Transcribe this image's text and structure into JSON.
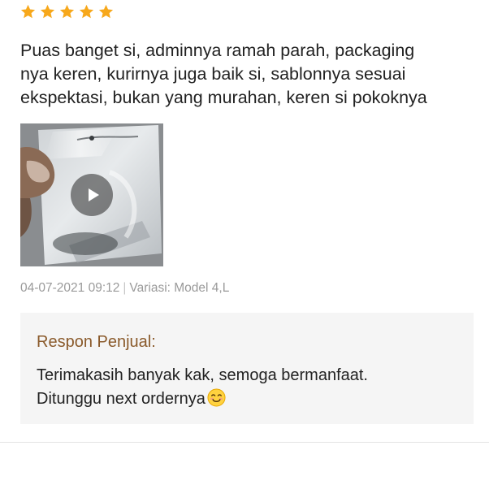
{
  "review": {
    "rating": 5,
    "max_rating": 5,
    "star_color": "#f7a81b",
    "text": "Puas banget si, adminnya ramah parah, packaging\nnya keren, kurirnya juga baik si, sablonnya sesuai\nekspektasi, bukan yang murahan, keren si pokoknya",
    "media": {
      "type": "video",
      "icon": "play-icon"
    },
    "date": "04-07-2021 09:12",
    "separator": "|",
    "variation": "Variasi: Model 4,L"
  },
  "seller_reply": {
    "label": "Respon Penjual:",
    "label_color": "#8a5a2b",
    "text": "Terimakasih banyak kak, semoga bermanfaat.\nDitunggu next ordernya",
    "emoji": "smiling-face-emoji"
  }
}
